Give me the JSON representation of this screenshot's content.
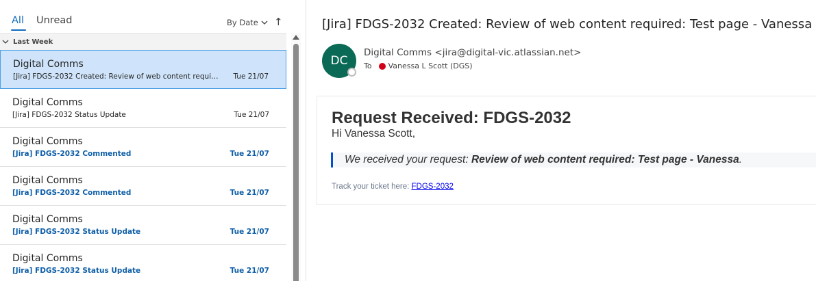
{
  "tabs": {
    "all": "All",
    "unread": "Unread"
  },
  "sort": {
    "label": "By Date",
    "chevron_icon": "chevron-down-icon",
    "direction_icon": "arrow-up-icon",
    "direction_glyph": "↑"
  },
  "group": {
    "label": "Last Week"
  },
  "messages": [
    {
      "sender": "Digital Comms",
      "subject": "[Jira] FDGS-2032 Created: Review of web content require...",
      "date": "Tue 21/07",
      "selected": true,
      "unread": false
    },
    {
      "sender": "Digital Comms",
      "subject": "[Jira] FDGS-2032 Status Update",
      "date": "Tue 21/07",
      "selected": false,
      "unread": false
    },
    {
      "sender": "Digital Comms",
      "subject": "[Jira] FDGS-2032 Commented",
      "date": "Tue 21/07",
      "selected": false,
      "unread": true
    },
    {
      "sender": "Digital Comms",
      "subject": "[Jira] FDGS-2032 Commented",
      "date": "Tue 21/07",
      "selected": false,
      "unread": true
    },
    {
      "sender": "Digital Comms",
      "subject": "[Jira] FDGS-2032 Status Update",
      "date": "Tue 21/07",
      "selected": false,
      "unread": true
    },
    {
      "sender": "Digital Comms",
      "subject": "[Jira] FDGS-2032 Status Update",
      "date": "Tue 21/07",
      "selected": false,
      "unread": true
    }
  ],
  "reading": {
    "subject": "[Jira] FDGS-2032 Created: Review of web content required: Test page - Vanessa",
    "avatar_initials": "DC",
    "avatar_color": "#0b6a55",
    "from": "Digital Comms <jira@digital-vic.atlassian.net>",
    "to_label": "To",
    "recipient": "Vanessa L Scott (DGS)",
    "recipient_status_color": "#d0021b"
  },
  "body": {
    "title": "Request Received: FDGS-2032",
    "greeting": "Hi Vanessa Scott,",
    "quote_prefix": "We received your request: ",
    "quote_bold": "Review of web content required: Test page - Vanessa",
    "quote_suffix": ".",
    "track_label": "Track your ticket here: ",
    "track_link": "FDGS-2032",
    "accent_color": "#0052cc"
  },
  "colors": {
    "accent": "#0f6cbd",
    "selected_bg": "#cfe4fa",
    "unread_text": "#0f5fa8"
  }
}
